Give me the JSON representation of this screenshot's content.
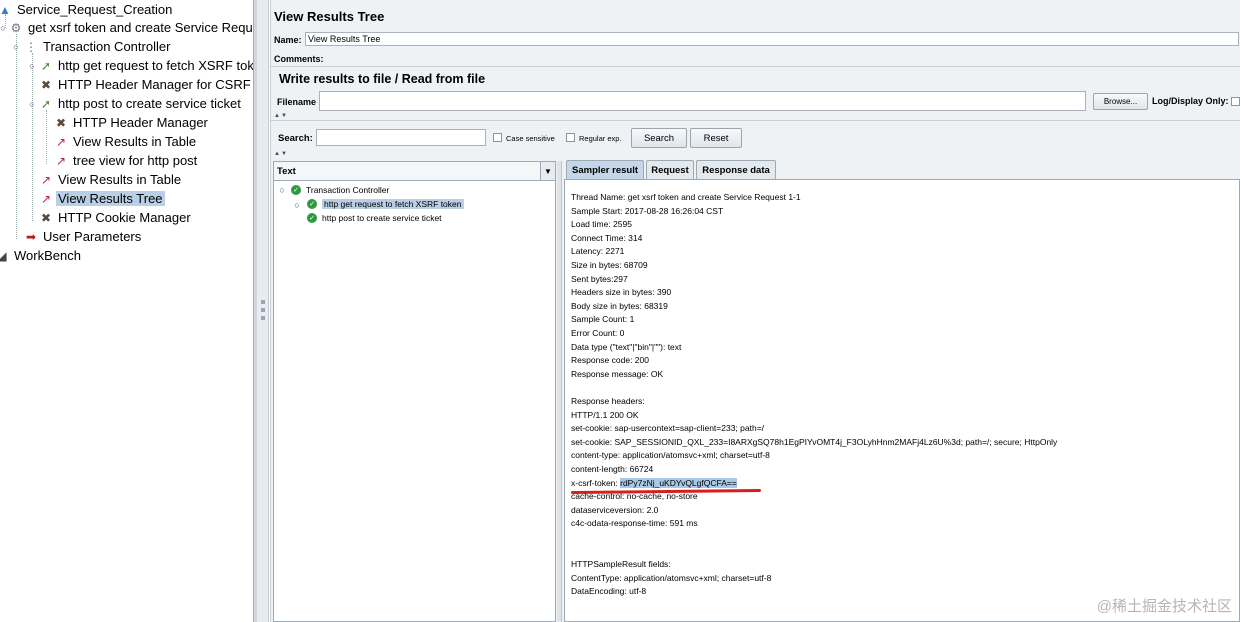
{
  "test_plan_tree": {
    "items": [
      "Service_Request_Creation",
      "get xsrf token and create Service Reques",
      "Transaction Controller",
      "http get request to fetch XSRF toker",
      "HTTP Header Manager for CSRF to",
      "http post to create service ticket",
      "HTTP Header Manager",
      "View Results in Table",
      "tree view for http post",
      "View Results in Table",
      "View Results Tree",
      "HTTP Cookie Manager",
      "User Parameters",
      "WorkBench"
    ]
  },
  "panel": {
    "title": "View Results Tree",
    "name_label": "Name:",
    "name_value": "View Results Tree",
    "comments_label": "Comments:",
    "file_group_title": "Write results to file / Read from file",
    "filename_label": "Filename",
    "browse_label": "Browse...",
    "log_display_label": "Log/Display Only:",
    "search_label": "Search:",
    "case_sensitive_label": "Case sensitive",
    "regular_exp_label": "Regular exp.",
    "search_button": "Search",
    "reset_button": "Reset",
    "renderer_value": "Text"
  },
  "results_tree": {
    "items": [
      "Transaction Controller",
      "http get request to fetch XSRF token",
      "http post to create service ticket"
    ]
  },
  "tabs": [
    "Sampler result",
    "Request",
    "Response data"
  ],
  "sampler_result": {
    "lines": [
      "Thread Name: get xsrf token and create Service Request 1-1",
      "Sample Start: 2017-08-28 16:26:04 CST",
      "Load time: 2595",
      "Connect Time: 314",
      "Latency: 2271",
      "Size in bytes: 68709",
      "Sent bytes:297",
      "Headers size in bytes: 390",
      "Body size in bytes: 68319",
      "Sample Count: 1",
      "Error Count: 0",
      "Data type (\"text\"|\"bin\"|\"\"): text",
      "Response code: 200",
      "Response message: OK",
      "",
      "Response headers:",
      "HTTP/1.1 200 OK",
      "set-cookie: sap-usercontext=sap-client=233; path=/",
      "set-cookie: SAP_SESSIONID_QXL_233=I8ARXgSQ78h1EgPIYvOMT4j_F3OLyhHnm2MAFj4Lz6U%3d; path=/; secure; HttpOnly",
      "content-type: application/atomsvc+xml; charset=utf-8",
      "content-length: 66724"
    ],
    "csrf_label": "x-csrf-token: ",
    "csrf_value": "rdPy7zNj_uKDYvQLgfQCFA==",
    "lines_after": [
      "cache-control: no-cache, no-store",
      "dataserviceversion: 2.0",
      "c4c-odata-response-time: 591  ms",
      "",
      "",
      "HTTPSampleResult fields:",
      "ContentType: application/atomsvc+xml; charset=utf-8",
      "DataEncoding: utf-8"
    ]
  },
  "watermark": "@稀土掘金技术社区"
}
